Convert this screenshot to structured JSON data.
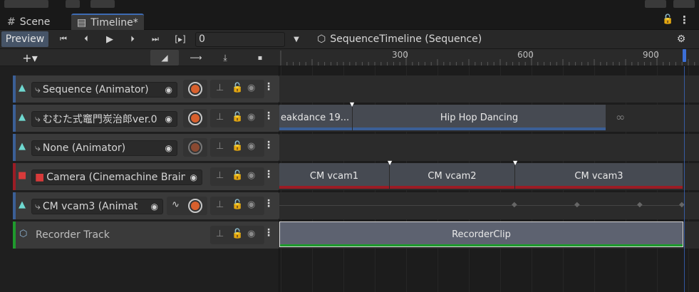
{
  "tabs": [
    {
      "label": "Scene",
      "icon": "hash-icon"
    },
    {
      "label": "Timeline*",
      "icon": "timeline-icon"
    }
  ],
  "toolbar": {
    "preview_label": "Preview",
    "frame_value": "0",
    "asset_label": "SequenceTimeline (Sequence)"
  },
  "ruler": {
    "ticks": [
      "300",
      "600",
      "900"
    ]
  },
  "tracks": [
    {
      "label": "Sequence (Animator)",
      "type": "animation"
    },
    {
      "label": "むむた式竈門炭治郎ver.0",
      "type": "animation"
    },
    {
      "label": "None (Animator)",
      "type": "animation"
    },
    {
      "label": "Camera (Cinemachine Brain",
      "type": "cinemachine"
    },
    {
      "label": "CM vcam3 (Animat",
      "type": "animation"
    },
    {
      "label": "Recorder Track",
      "type": "recorder"
    }
  ],
  "clips": {
    "breakdance": "eakdance 19...",
    "hiphop": "Hip Hop Dancing",
    "vcam1": "CM vcam1",
    "vcam2": "CM vcam2",
    "vcam3": "CM vcam3",
    "recorder": "RecorderClip"
  },
  "colors": {
    "animation_accent": "#3b5f96",
    "cinemachine_accent": "#9b1c25",
    "recorder_accent": "#1f9a2d",
    "preview_active": "#465467",
    "playhead": "#3c6fd6"
  }
}
